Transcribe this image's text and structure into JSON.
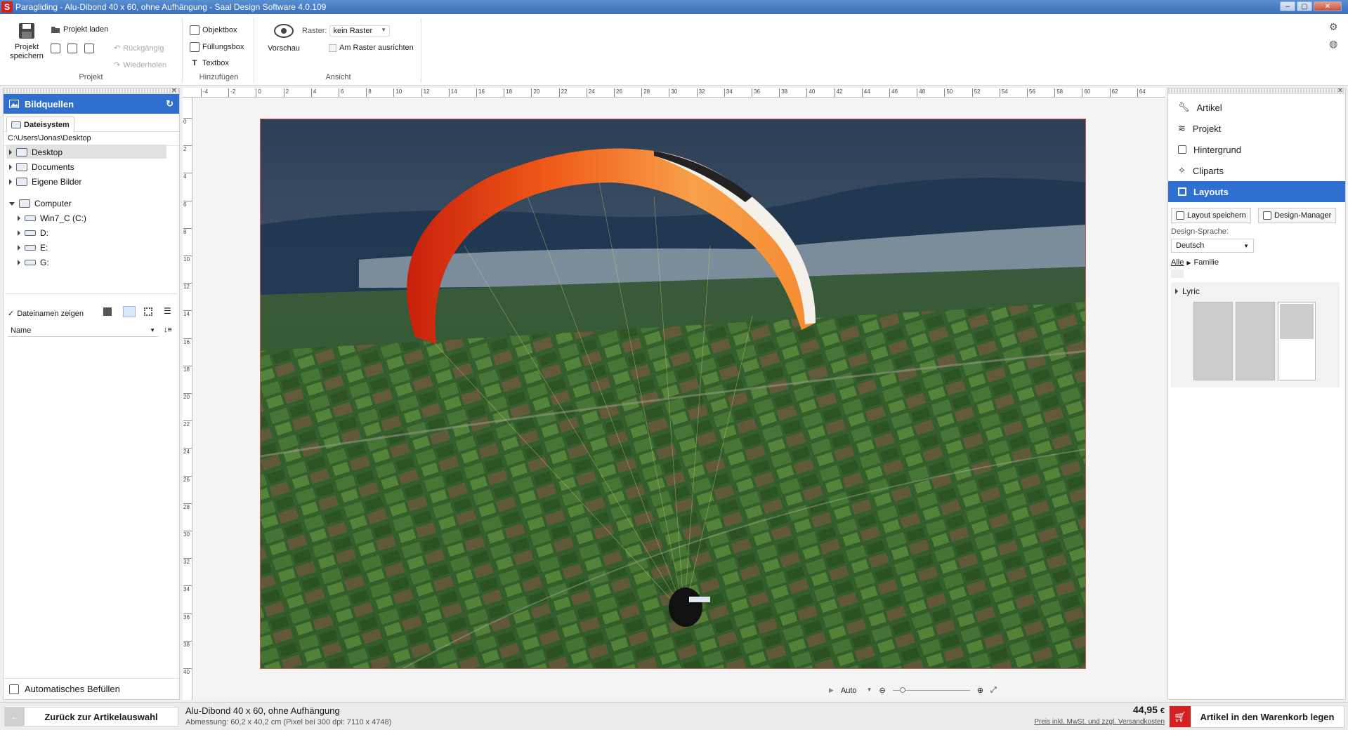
{
  "window": {
    "title": "Paragliding - Alu-Dibond 40 x 60, ohne Aufhängung - Saal Design Software 4.0.109"
  },
  "ribbon": {
    "projekt": {
      "label": "Projekt",
      "save_label": "Projekt speichern",
      "load_label": "Projekt laden",
      "undo_label": "Rückgängig",
      "redo_label": "Wiederholen"
    },
    "hinzufuegen": {
      "label": "Hinzufügen",
      "objektbox": "Objektbox",
      "fuellungsbox": "Füllungsbox",
      "textbox": "Textbox"
    },
    "ansicht": {
      "label": "Ansicht",
      "vorschau": "Vorschau",
      "raster_label": "Raster:",
      "raster_value": "kein Raster",
      "am_raster": "Am Raster ausrichten"
    }
  },
  "left_panel": {
    "title": "Bildquellen",
    "tab": "Dateisystem",
    "path": "C:\\Users\\Jonas\\Desktop",
    "tree": [
      {
        "label": "Desktop",
        "selected": true
      },
      {
        "label": "Documents"
      },
      {
        "label": "Eigene Bilder"
      },
      {
        "label": "Computer"
      },
      {
        "label": "Win7_C (C:)"
      },
      {
        "label": "D:"
      },
      {
        "label": "E:"
      },
      {
        "label": "G:"
      }
    ],
    "show_filenames": "Dateinamen zeigen",
    "sort_value": "Name",
    "auto_fill": "Automatisches Befüllen"
  },
  "ruler": {
    "h_labels": [
      "-4",
      "-2",
      "0",
      "2",
      "4",
      "6",
      "8",
      "10",
      "12",
      "14",
      "16",
      "18",
      "20",
      "22",
      "24",
      "26",
      "28",
      "30",
      "32",
      "34",
      "36",
      "38",
      "40",
      "42",
      "44",
      "46",
      "48",
      "50",
      "52",
      "54",
      "56",
      "58",
      "60",
      "62",
      "64"
    ],
    "v_labels": [
      "0",
      "2",
      "4",
      "6",
      "8",
      "10",
      "12",
      "14",
      "16",
      "18",
      "20",
      "22",
      "24",
      "26",
      "28",
      "30",
      "32",
      "34",
      "36",
      "38",
      "40"
    ]
  },
  "right_panel": {
    "nav": [
      {
        "label": "Artikel",
        "icon": "wrench-icon"
      },
      {
        "label": "Projekt",
        "icon": "layers-icon"
      },
      {
        "label": "Hintergrund",
        "icon": "background-icon"
      },
      {
        "label": "Cliparts",
        "icon": "clipart-icon"
      },
      {
        "label": "Layouts",
        "icon": "layouts-icon",
        "active": true
      }
    ],
    "layout_save": "Layout speichern",
    "design_manager": "Design-Manager",
    "design_lang_label": "Design-Sprache:",
    "design_lang_value": "Deutsch",
    "crumb_all": "Alle",
    "crumb_family": "Familie",
    "category": "Lyric"
  },
  "zoom": {
    "value": "Auto"
  },
  "status": {
    "back_button": "Zurück zur Artikelauswahl",
    "article_name": "Alu-Dibond 40 x 60, ohne Aufhängung",
    "dimensions": "Abmessung: 60,2 x 40,2 cm (Pixel bei 300 dpi: 7110 x 4748)",
    "price": "44,95",
    "currency": "€",
    "price_note": "Preis inkl. MwSt. und zzgl. Versandkosten",
    "cart_button": "Artikel in den Warenkorb legen"
  },
  "colors": {
    "accent": "#2e6fcf",
    "cart": "#d42020"
  }
}
